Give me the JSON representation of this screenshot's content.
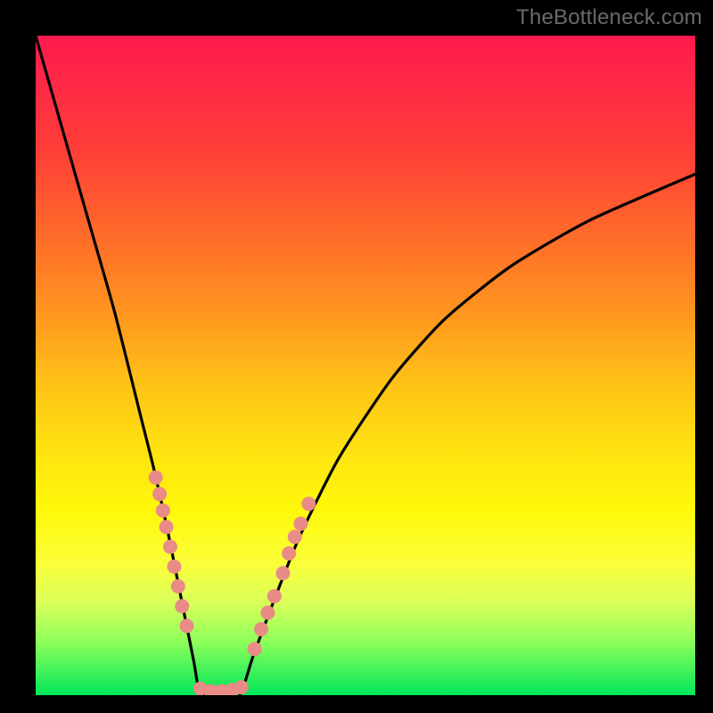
{
  "watermark": "TheBottleneck.com",
  "colors": {
    "background": "#000000",
    "gradient_top": "#ff1a4d",
    "gradient_bottom": "#00e65a",
    "curve": "#000000",
    "dots": "#e98b86"
  },
  "chart_data": {
    "type": "line",
    "title": "",
    "xlabel": "",
    "ylabel": "",
    "xlim": [
      0,
      100
    ],
    "ylim": [
      0,
      100
    ],
    "series": [
      {
        "name": "left-branch",
        "x": [
          0,
          4,
          8,
          12,
          16,
          18,
          20,
          22,
          23,
          24,
          24.5,
          25
        ],
        "y": [
          100,
          86,
          72,
          58,
          42,
          34,
          25,
          15,
          10,
          5,
          2,
          0
        ]
      },
      {
        "name": "valley-floor",
        "x": [
          25,
          27,
          29,
          31
        ],
        "y": [
          0,
          0,
          0,
          0
        ]
      },
      {
        "name": "right-branch",
        "x": [
          31,
          33,
          36,
          40,
          46,
          54,
          62,
          72,
          84,
          100
        ],
        "y": [
          0,
          6,
          14,
          24,
          36,
          48,
          57,
          65,
          72,
          79
        ]
      }
    ],
    "scatter": [
      {
        "name": "left-cluster",
        "points": [
          {
            "x": 18.2,
            "y": 33.0
          },
          {
            "x": 18.8,
            "y": 30.5
          },
          {
            "x": 19.3,
            "y": 28.0
          },
          {
            "x": 19.8,
            "y": 25.5
          },
          {
            "x": 20.4,
            "y": 22.5
          },
          {
            "x": 21.0,
            "y": 19.5
          },
          {
            "x": 21.6,
            "y": 16.5
          },
          {
            "x": 22.2,
            "y": 13.5
          },
          {
            "x": 22.9,
            "y": 10.5
          }
        ]
      },
      {
        "name": "bottom-cluster",
        "points": [
          {
            "x": 25.0,
            "y": 1.0
          },
          {
            "x": 26.6,
            "y": 0.6
          },
          {
            "x": 28.2,
            "y": 0.6
          },
          {
            "x": 29.8,
            "y": 0.8
          },
          {
            "x": 31.2,
            "y": 1.2
          }
        ]
      },
      {
        "name": "right-cluster",
        "points": [
          {
            "x": 33.2,
            "y": 7.0
          },
          {
            "x": 34.2,
            "y": 10.0
          },
          {
            "x": 35.2,
            "y": 12.5
          },
          {
            "x": 36.2,
            "y": 15.0
          },
          {
            "x": 37.5,
            "y": 18.5
          },
          {
            "x": 38.4,
            "y": 21.5
          },
          {
            "x": 39.3,
            "y": 24.0
          },
          {
            "x": 40.2,
            "y": 26.0
          },
          {
            "x": 41.4,
            "y": 29.0
          }
        ]
      }
    ]
  }
}
